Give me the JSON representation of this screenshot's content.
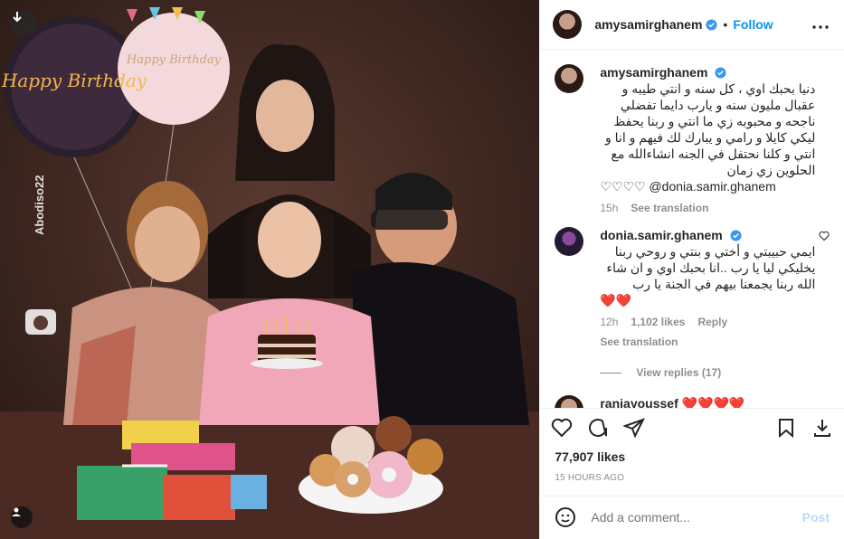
{
  "header": {
    "username": "amysamirghanem",
    "separator": "•",
    "follow_label": "Follow"
  },
  "media": {
    "watermark": "Abodiso22",
    "balloon_text": "Happy Birthday",
    "balloon_text_2": "Happy Birthday",
    "colors": {
      "background": "#3a2621",
      "balloon_pink": "#f3d9db",
      "dress_pink": "#f2a7b8"
    }
  },
  "caption": {
    "username": "amysamirghanem",
    "text": "دنيا بحبك اوي ، كل سنه و انتي طيبه و عقبال مليون سنه و يارب دايما تفضلي ناجحه و محبوبه زي ما انتي و ربنا يحفظ ليكي كايلا و رامي و يبارك لك فيهم و انا و انتي و كلنا نحتفل في الجنه انشاءالله مع الحلوين زي زمان",
    "hearts": "♡♡♡♡",
    "mention": "@donia.samir.ghanem",
    "time": "15h",
    "see_translation": "See translation"
  },
  "comments": [
    {
      "username": "donia.samir.ghanem",
      "text": "ايمي حبيبتي و أختي و بنتي و روحي ربنا يخليكي ليا يا رب ..انا بحبك اوي و ان شاء الله ربنا يجمعنا بيهم في الجنة يا رب",
      "hearts": "❤️❤️",
      "time": "12h",
      "likes": "1,102 likes",
      "reply_label": "Reply",
      "see_translation": "See translation",
      "view_replies": "View replies (17)"
    },
    {
      "username": "ranjayoussef",
      "text": "❤️❤️❤️❤️"
    }
  ],
  "actions": {
    "likes": "77,907 likes",
    "timestamp": "15 HOURS AGO",
    "comment_placeholder": "Add a comment...",
    "post_label": "Post"
  },
  "icons": [
    "download-icon",
    "user-tag-icon",
    "verified-icon",
    "more-icon",
    "heart-icon",
    "comment-icon",
    "share-icon",
    "save-icon",
    "emoji-icon",
    "camera-icon"
  ]
}
